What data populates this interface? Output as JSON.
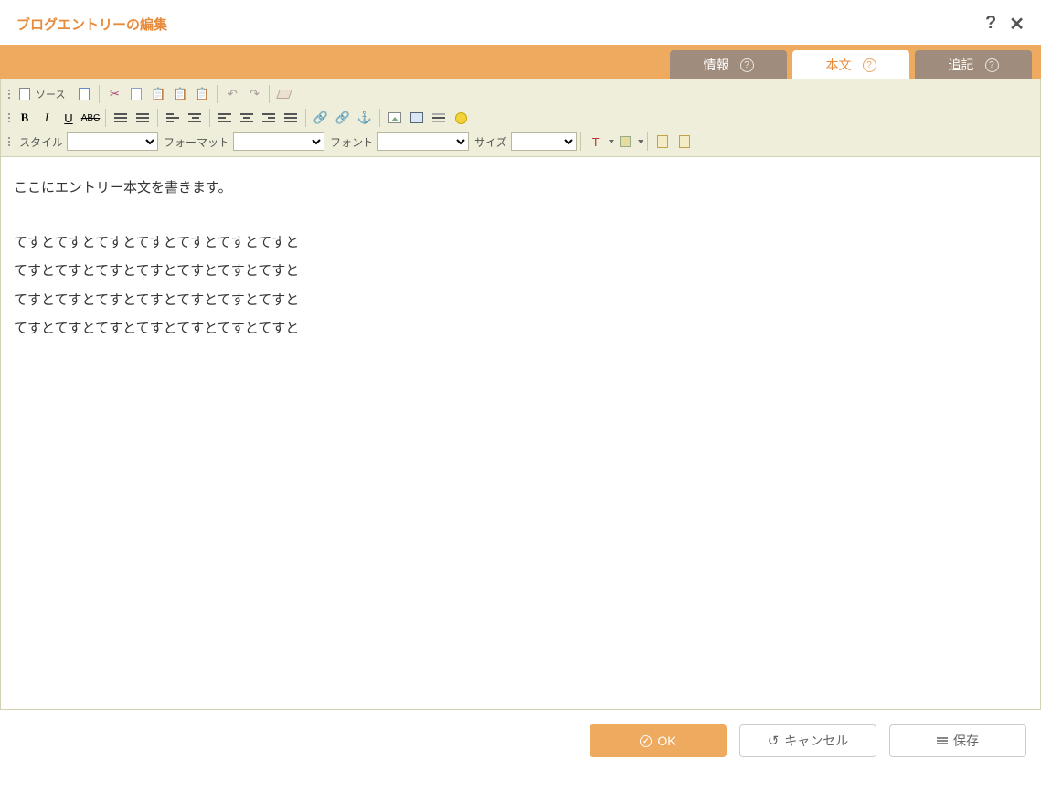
{
  "header": {
    "title": "ブログエントリーの編集"
  },
  "tabs": {
    "info": "情報",
    "body": "本文",
    "more": "追記"
  },
  "toolbar": {
    "source_label": "ソース",
    "style_label": "スタイル",
    "format_label": "フォーマット",
    "font_label": "フォント",
    "size_label": "サイズ",
    "bold": "B",
    "italic": "I",
    "underline": "U",
    "strike": "ABC"
  },
  "content": {
    "line1": "ここにエントリー本文を書きます。",
    "line2": "てすとてすとてすとてすとてすとてすとてすと",
    "line3": "てすとてすとてすとてすとてすとてすとてすと",
    "line4": "てすとてすとてすとてすとてすとてすとてすと",
    "line5": "てすとてすとてすとてすとてすとてすとてすと"
  },
  "buttons": {
    "ok": "OK",
    "cancel": "キャンセル",
    "save": "保存"
  }
}
